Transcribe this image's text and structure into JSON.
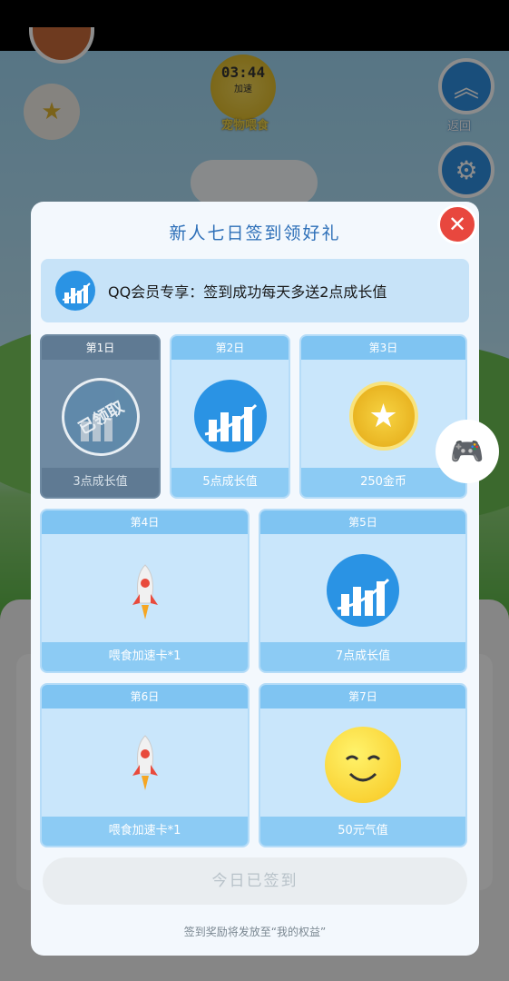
{
  "hud": {
    "timer": "03:44",
    "timer_sub": "加速",
    "pet_label": "宠物喂食",
    "back_label": "返回"
  },
  "dialog": {
    "title": "新人七日签到领好礼",
    "vip_banner": "QQ会员专享：签到成功每天多送2点成长值",
    "days": [
      {
        "label": "第1日",
        "reward": "3点成长值",
        "icon": "growth-icon",
        "claimed": true,
        "stamp": "已领取"
      },
      {
        "label": "第2日",
        "reward": "5点成长值",
        "icon": "growth-icon",
        "claimed": false
      },
      {
        "label": "第3日",
        "reward": "250金币",
        "icon": "gold-coin-icon",
        "claimed": false
      },
      {
        "label": "第4日",
        "reward": "喂食加速卡*1",
        "icon": "rocket-icon",
        "claimed": false
      },
      {
        "label": "第5日",
        "reward": "7点成长值",
        "icon": "growth-icon",
        "claimed": false
      },
      {
        "label": "第6日",
        "reward": "喂食加速卡*1",
        "icon": "rocket-icon",
        "claimed": false
      },
      {
        "label": "第7日",
        "reward": "50元气值",
        "icon": "smile-icon",
        "claimed": false
      }
    ],
    "signed_button": "今日已签到",
    "footnote": "签到奖励将发放至“我的权益”"
  },
  "colors": {
    "accent_blue": "#2a93e4",
    "close_red": "#e8473e",
    "card_bg": "#c9e6fb"
  }
}
